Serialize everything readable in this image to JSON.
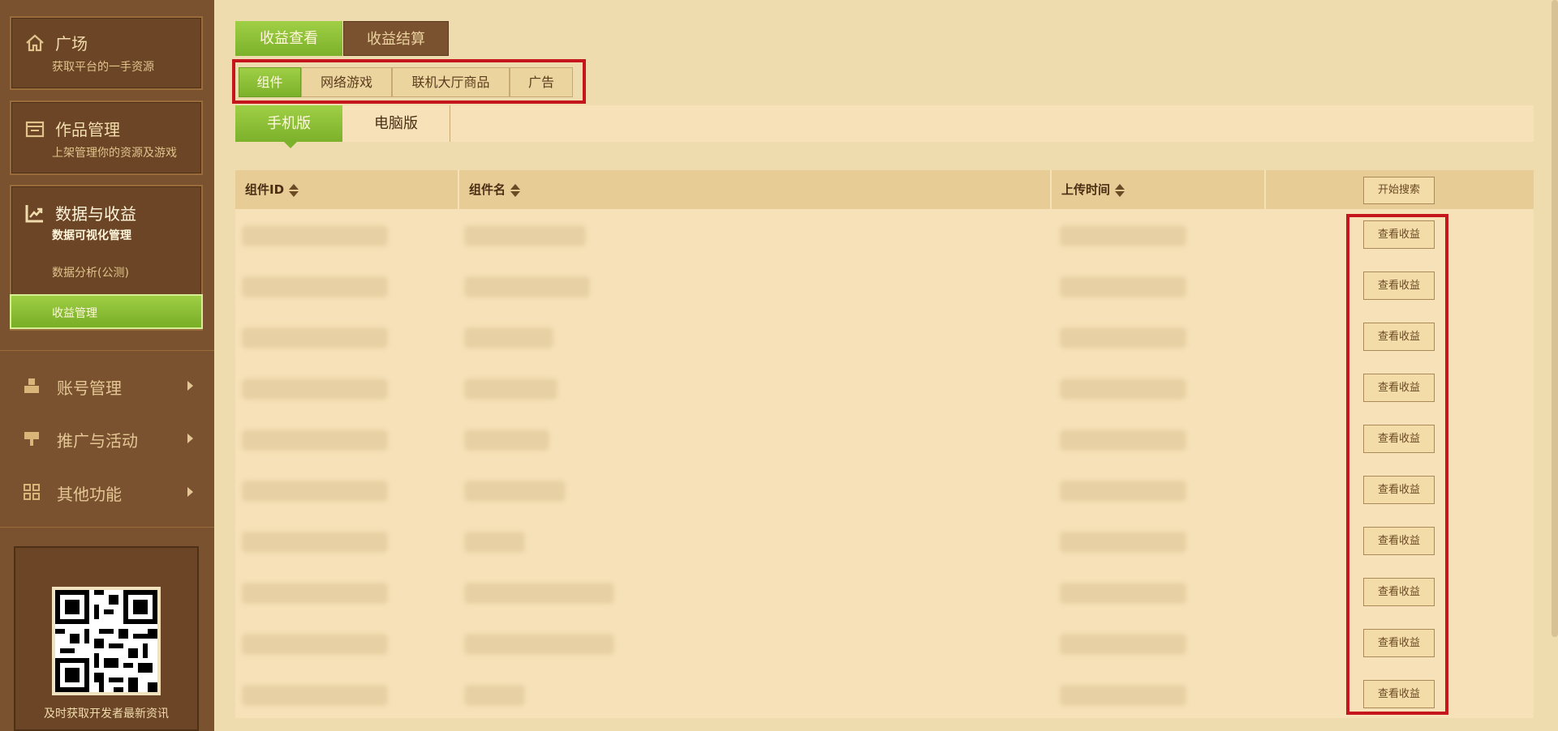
{
  "sidebar": {
    "home": {
      "title": "广场",
      "sub": "获取平台的一手资源",
      "icon": "home-icon"
    },
    "works": {
      "title": "作品管理",
      "sub": "上架管理你的资源及游戏",
      "icon": "folder-icon"
    },
    "data": {
      "title": "数据与收益",
      "sub": "数据可视化管理",
      "sub_item": "数据分析(公测)",
      "active_item": "收益管理",
      "icon": "chart-icon"
    },
    "menu": [
      {
        "label": "账号管理",
        "icon": "account-icon"
      },
      {
        "label": "推广与活动",
        "icon": "promotion-icon"
      },
      {
        "label": "其他功能",
        "icon": "grid-icon"
      }
    ],
    "qr_caption": "及时获取开发者最新资讯"
  },
  "main": {
    "top_tabs": {
      "view": "收益查看",
      "settle": "收益结算"
    },
    "category_tabs": [
      "组件",
      "网络游戏",
      "联机大厅商品",
      "广告"
    ],
    "platform_tabs": [
      "手机版",
      "电脑版"
    ],
    "table": {
      "headers": {
        "id": "组件ID",
        "name": "组件名",
        "time": "上传时间"
      },
      "search_button": "开始搜索",
      "row_action": "查看收益",
      "row_count": 10
    }
  },
  "colors": {
    "green": "#8cc137",
    "brown": "#7a5230",
    "highlight": "#c4161c"
  }
}
